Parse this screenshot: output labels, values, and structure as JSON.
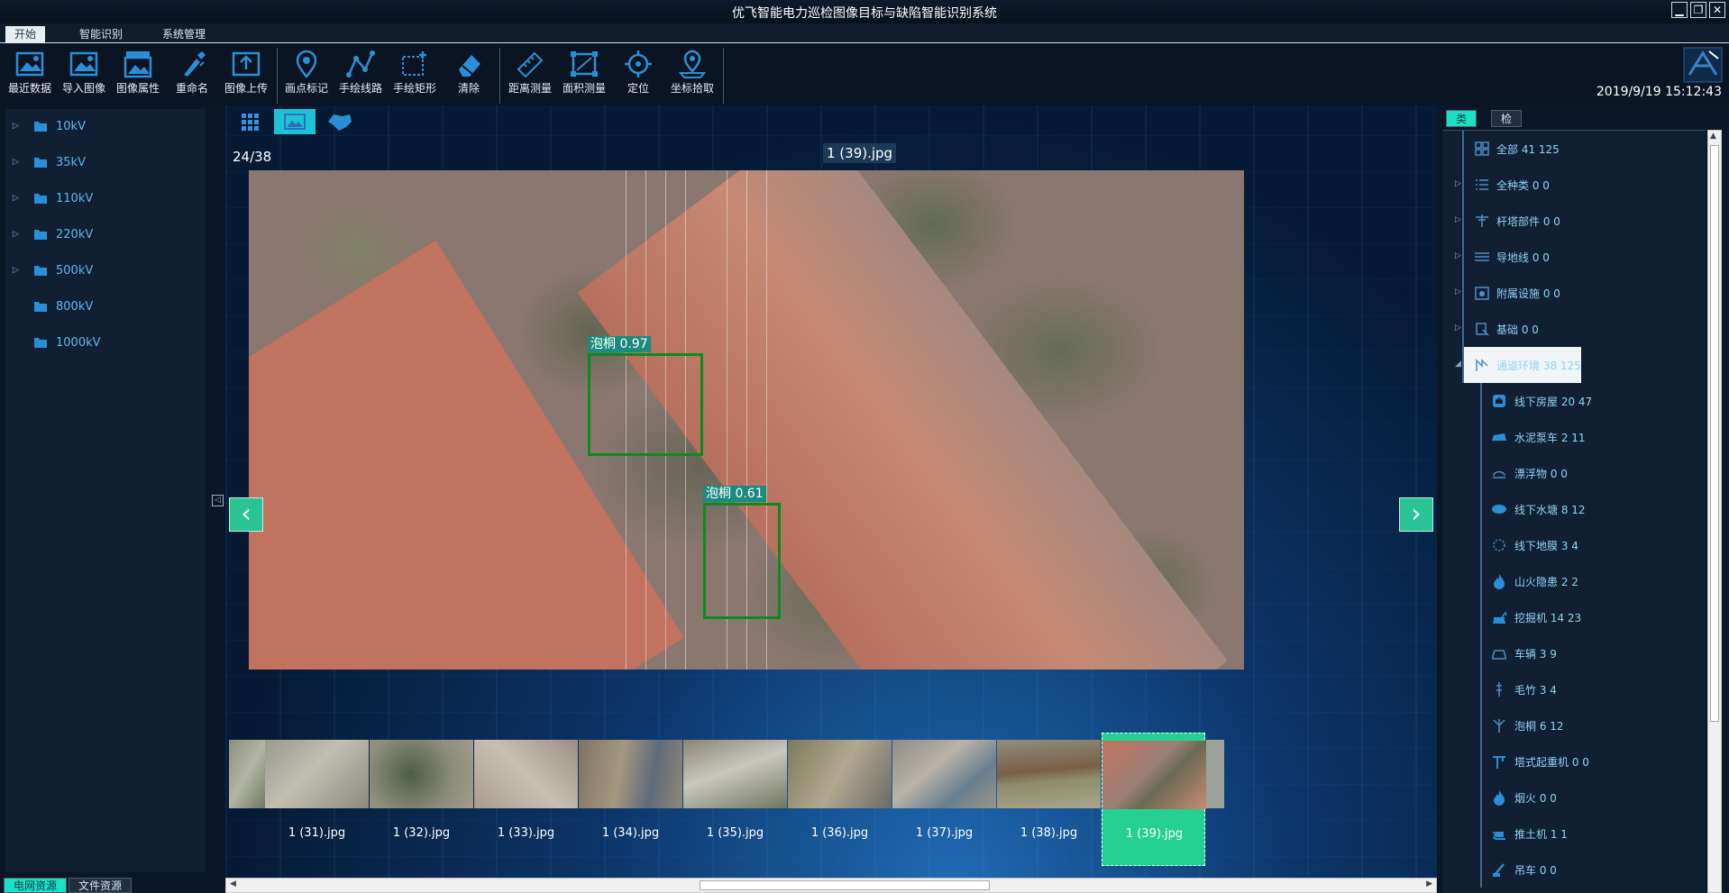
{
  "app": {
    "title": "优飞智能电力巡检图像目标与缺陷智能识别系统",
    "window_buttons": [
      "▁",
      "❐",
      "✕"
    ],
    "datetime": "2019/9/19 15:12:43"
  },
  "menu": {
    "tabs": [
      {
        "label": "开始",
        "active": true
      },
      {
        "label": "智能识别",
        "active": false
      },
      {
        "label": "系统管理",
        "active": false
      }
    ]
  },
  "toolbar": {
    "tools": [
      {
        "label": "最近数据",
        "icon": "recent-data-icon"
      },
      {
        "label": "导入图像",
        "icon": "import-image-icon"
      },
      {
        "label": "图像属性",
        "icon": "image-properties-icon"
      },
      {
        "label": "重命名",
        "icon": "rename-icon"
      },
      {
        "label": "图像上传",
        "icon": "upload-icon"
      },
      {
        "label": "画点标记",
        "icon": "point-marker-icon"
      },
      {
        "label": "手绘线路",
        "icon": "draw-line-icon"
      },
      {
        "label": "手绘矩形",
        "icon": "draw-rect-icon"
      },
      {
        "label": "清除",
        "icon": "eraser-icon"
      },
      {
        "label": "距离测量",
        "icon": "ruler-icon"
      },
      {
        "label": "面积测量",
        "icon": "area-measure-icon"
      },
      {
        "label": "定位",
        "icon": "locate-icon"
      },
      {
        "label": "坐标拾取",
        "icon": "coordinate-pick-icon"
      }
    ]
  },
  "left_tree": {
    "items": [
      {
        "label": "10kV",
        "expandable": true
      },
      {
        "label": "35kV",
        "expandable": true
      },
      {
        "label": "110kV",
        "expandable": true
      },
      {
        "label": "220kV",
        "expandable": true
      },
      {
        "label": "500kV",
        "expandable": true
      },
      {
        "label": "800kV",
        "expandable": false
      },
      {
        "label": "1000kV",
        "expandable": false
      }
    ]
  },
  "left_tabs": [
    {
      "label": "电网资源",
      "active": true
    },
    {
      "label": "文件资源",
      "active": false
    }
  ],
  "viewer": {
    "page_info": "24/38",
    "image_name": "1 (39).jpg",
    "detections": [
      {
        "label": "泡桐 0.97"
      },
      {
        "label": "泡桐 0.61"
      }
    ],
    "prev_label": "‹",
    "next_label": "›"
  },
  "thumbnails": [
    {
      "name": "",
      "active": false
    },
    {
      "name": "1 (31).jpg",
      "active": false
    },
    {
      "name": "1 (32).jpg",
      "active": false
    },
    {
      "name": "1 (33).jpg",
      "active": false
    },
    {
      "name": "1 (34).jpg",
      "active": false
    },
    {
      "name": "1 (35).jpg",
      "active": false
    },
    {
      "name": "1 (36).jpg",
      "active": false
    },
    {
      "name": "1 (37).jpg",
      "active": false
    },
    {
      "name": "1 (38).jpg",
      "active": false
    },
    {
      "name": "1 (39).jpg",
      "active": true
    }
  ],
  "right_tabs": [
    {
      "label": "类型",
      "active": true
    },
    {
      "label": "检测",
      "active": false
    }
  ],
  "right_tree": {
    "nodes": [
      {
        "label": "全部 41 125",
        "level": 0,
        "expandable": false,
        "selected": false,
        "icon": "grid-icon"
      },
      {
        "label": "全种类 0 0",
        "level": 0,
        "expandable": true,
        "selected": false,
        "icon": "list-icon"
      },
      {
        "label": "杆塔部件 0 0",
        "level": 0,
        "expandable": true,
        "selected": false,
        "icon": "tower-icon"
      },
      {
        "label": "导地线 0 0",
        "level": 0,
        "expandable": true,
        "selected": false,
        "icon": "wire-icon"
      },
      {
        "label": "附属设施 0 0",
        "level": 0,
        "expandable": true,
        "selected": false,
        "icon": "facility-icon"
      },
      {
        "label": "基础 0 0",
        "level": 0,
        "expandable": true,
        "selected": false,
        "icon": "foundation-icon"
      },
      {
        "label": "通道环境 38 125",
        "level": 0,
        "expandable": true,
        "expanded": true,
        "selected": true,
        "icon": "environment-icon"
      },
      {
        "label": "线下房屋 20 47",
        "level": 1,
        "icon": "house-icon"
      },
      {
        "label": "水泥泵车 2 11",
        "level": 1,
        "icon": "pump-truck-icon"
      },
      {
        "label": "漂浮物 0 0",
        "level": 1,
        "icon": "floating-object-icon"
      },
      {
        "label": "线下水塘 8 12",
        "level": 1,
        "icon": "pond-icon"
      },
      {
        "label": "线下地膜 3 4",
        "level": 1,
        "icon": "film-icon"
      },
      {
        "label": "山火隐患 2 2",
        "level": 1,
        "icon": "fire-icon"
      },
      {
        "label": "挖掘机 14 23",
        "level": 1,
        "icon": "excavator-icon"
      },
      {
        "label": "车辆 3 9",
        "level": 1,
        "icon": "car-icon"
      },
      {
        "label": "毛竹 3 4",
        "level": 1,
        "icon": "bamboo-icon"
      },
      {
        "label": "泡桐 6 12",
        "level": 1,
        "icon": "tree-icon"
      },
      {
        "label": "塔式起重机 0 0",
        "level": 1,
        "icon": "tower-crane-icon"
      },
      {
        "label": "烟火 0 0",
        "level": 1,
        "icon": "smoke-fire-icon"
      },
      {
        "label": "推土机 1 1",
        "level": 1,
        "icon": "bulldozer-icon"
      },
      {
        "label": "吊车 0 0",
        "level": 1,
        "icon": "crane-icon"
      }
    ]
  },
  "colors": {
    "accent": "#1ce0c6",
    "label_blue": "#59b8f0",
    "detect_box": "#0e8a1e",
    "thumb_active": "#26d092"
  }
}
